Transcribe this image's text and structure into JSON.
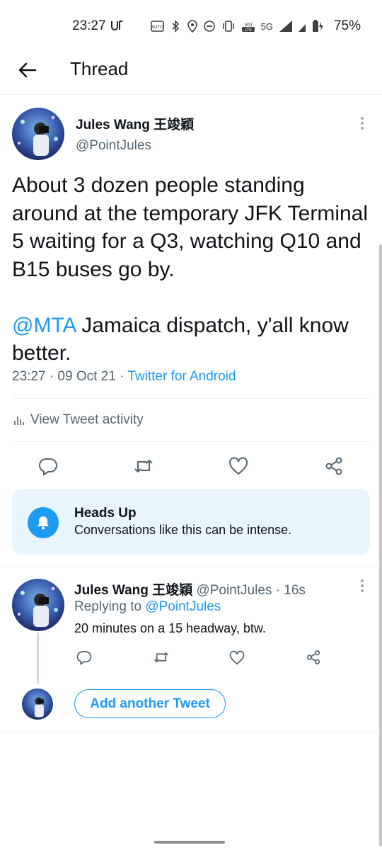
{
  "status_bar": {
    "time": "23:27",
    "time_icon": "vpn-key-icon",
    "network": "5G",
    "battery": "75%"
  },
  "header": {
    "title": "Thread",
    "back_icon": "back-arrow-icon"
  },
  "main_tweet": {
    "author_name": "Jules Wang 王竣穎",
    "author_handle": "@PointJules",
    "text_line1": "About 3 dozen people standing around at the temporary JFK Terminal 5 waiting for a Q3, watching Q10 and B15 buses go by.",
    "mention": "@MTA",
    "text_line2": " Jamaica dispatch, y'all know better.",
    "timestamp": "23:27 · 09 Oct 21 · ",
    "client": "Twitter for Android",
    "activity_label": "View Tweet activity"
  },
  "heads_up": {
    "title": "Heads Up",
    "body": "Conversations like this can be intense."
  },
  "reply": {
    "author_name": "Jules Wang 王竣穎",
    "author_handle_time": " @PointJules · 16s",
    "replying_prefix": "Replying to ",
    "replying_handle": "@PointJules",
    "text": "20 minutes on a 15 headway, btw."
  },
  "compose": {
    "add_another_label": "Add another Tweet"
  },
  "colors": {
    "accent": "#1d9bf0",
    "secondary_text": "#536471",
    "heads_up_bg": "#e8f5fd"
  }
}
